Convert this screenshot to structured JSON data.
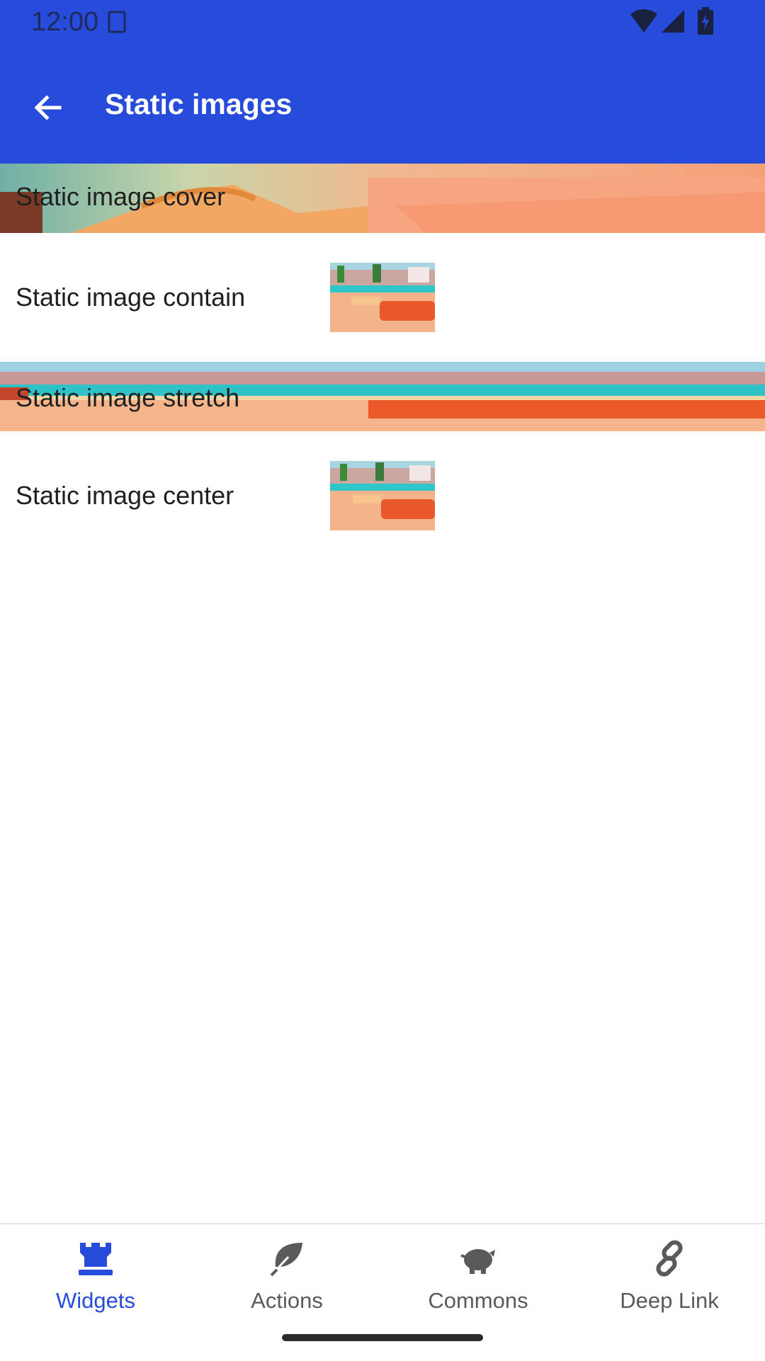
{
  "status_bar": {
    "time": "12:00"
  },
  "app_bar": {
    "title": "Static images"
  },
  "list": [
    {
      "label": "Static image cover"
    },
    {
      "label": "Static image contain"
    },
    {
      "label": "Static image stretch"
    },
    {
      "label": "Static image center"
    }
  ],
  "bottom_nav": [
    {
      "label": "Widgets",
      "icon": "castle-icon"
    },
    {
      "label": "Actions",
      "icon": "leaf-icon"
    },
    {
      "label": "Commons",
      "icon": "piggy-bank-icon"
    },
    {
      "label": "Deep Link",
      "icon": "link-icon"
    }
  ],
  "colors": {
    "primary": "#274BDB",
    "active_nav": "#274BDB",
    "inactive_nav": "#5a5a5a"
  }
}
